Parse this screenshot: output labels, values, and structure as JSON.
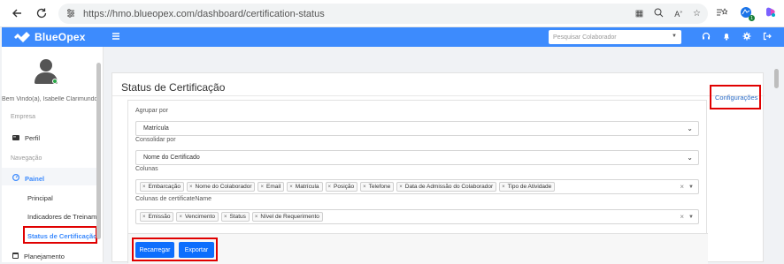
{
  "browser": {
    "url": "https://hmo.blueopex.com/dashboard/certification-status"
  },
  "header": {
    "brand": "BlueOpex",
    "search_placeholder": "Pesquisar Colaborador"
  },
  "sidebar": {
    "welcome": "Bem Vindo(a), Isabelle Clarimundo",
    "section_empresa": "Empresa",
    "perfil": "Perfil",
    "section_navegacao": "Navegação",
    "painel": "Painel",
    "sub_items": [
      "Principal",
      "Indicadores de Treinam",
      "Status de Certificação"
    ],
    "planejamento": "Planejamento"
  },
  "main": {
    "title": "Status de Certificação",
    "config_link": "Configurações",
    "agrupar_label": "Agrupar por",
    "agrupar_value": "Matrícula",
    "consolidar_label": "Consolidar por",
    "consolidar_value": "Nome do Certificado",
    "colunas_label": "Colunas",
    "colunas": [
      "Embarcação",
      "Nome do Colaborador",
      "Email",
      "Matrícula",
      "Posição",
      "Telefone",
      "Data de Admissão do Colaborador",
      "Tipo de Atividade"
    ],
    "colunas_cert_label": "Colunas de  certificateName",
    "colunas_cert": [
      "Emissão",
      "Vencimento",
      "Status",
      "Nível de Requerimento"
    ],
    "btn_recarregar": "Recarregar",
    "btn_exportar": "Exportar"
  },
  "colors": {
    "brand": "#3d8bfd",
    "button": "#0d6efd",
    "highlight": "#e00000"
  }
}
